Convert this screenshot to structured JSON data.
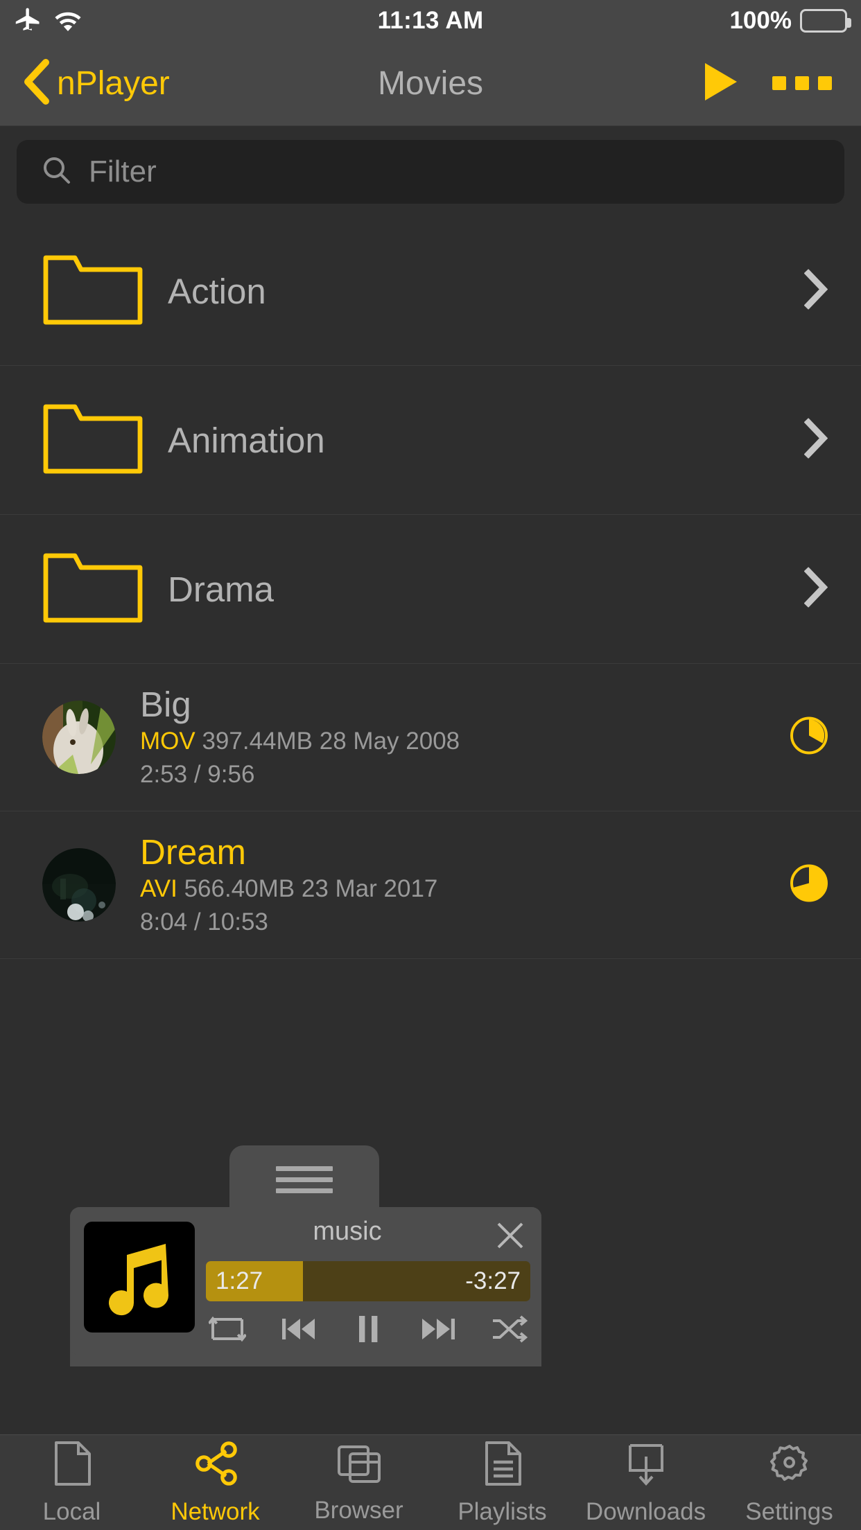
{
  "status_bar": {
    "airplane_icon": "airplane-mode-icon",
    "wifi_icon": "wifi-icon",
    "time": "11:13 AM",
    "battery_percent": "100%"
  },
  "nav_bar": {
    "back_label": "nPlayer",
    "back_icon": "chevron-left-icon",
    "title": "Movies",
    "play_icon": "play-icon",
    "more_icon": "more-horizontal-icon"
  },
  "filter": {
    "placeholder": "Filter",
    "value": "",
    "icon": "search-icon"
  },
  "list": {
    "folders": [
      {
        "name": "Action",
        "icon": "folder-icon",
        "chevron": "chevron-right-icon"
      },
      {
        "name": "Animation",
        "icon": "folder-icon",
        "chevron": "chevron-right-icon"
      },
      {
        "name": "Drama",
        "icon": "folder-icon",
        "chevron": "chevron-right-icon"
      }
    ],
    "files": [
      {
        "name": "Big",
        "watched": false,
        "extension": "MOV",
        "size": "397.44MB",
        "date": "28 May 2008",
        "position": "2:53",
        "duration": "9:56",
        "time_line": "2:53 / 9:56",
        "progress_percent": 29
      },
      {
        "name": "Dream",
        "watched": true,
        "extension": "AVI",
        "size": "566.40MB",
        "date": "23 Mar 2017",
        "position": "8:04",
        "duration": "10:53",
        "time_line": "8:04 / 10:53",
        "progress_percent": 74
      }
    ]
  },
  "mini_player": {
    "handle_icon": "drag-handle-icon",
    "album_icon": "music-note-icon",
    "track_title": "music",
    "close_icon": "close-icon",
    "elapsed": "1:27",
    "remaining": "-3:27",
    "progress_percent": 30,
    "controls": [
      {
        "name": "repeat-button",
        "icon": "repeat-icon"
      },
      {
        "name": "previous-button",
        "icon": "skip-back-icon"
      },
      {
        "name": "pause-button",
        "icon": "pause-icon"
      },
      {
        "name": "next-button",
        "icon": "skip-forward-icon"
      },
      {
        "name": "shuffle-button",
        "icon": "shuffle-icon"
      }
    ]
  },
  "tab_bar": {
    "items": [
      {
        "label": "Local",
        "icon": "document-icon",
        "active": false
      },
      {
        "label": "Network",
        "icon": "share-icon",
        "active": true
      },
      {
        "label": "Browser",
        "icon": "windows-icon",
        "active": false
      },
      {
        "label": "Playlists",
        "icon": "list-doc-icon",
        "active": false
      },
      {
        "label": "Downloads",
        "icon": "download-icon",
        "active": false
      },
      {
        "label": "Settings",
        "icon": "gear-icon",
        "active": false
      }
    ]
  },
  "colors": {
    "accent": "#FFC907",
    "background": "#2e2e2e",
    "chrome": "#474747",
    "text_secondary": "#9a9a9a"
  }
}
